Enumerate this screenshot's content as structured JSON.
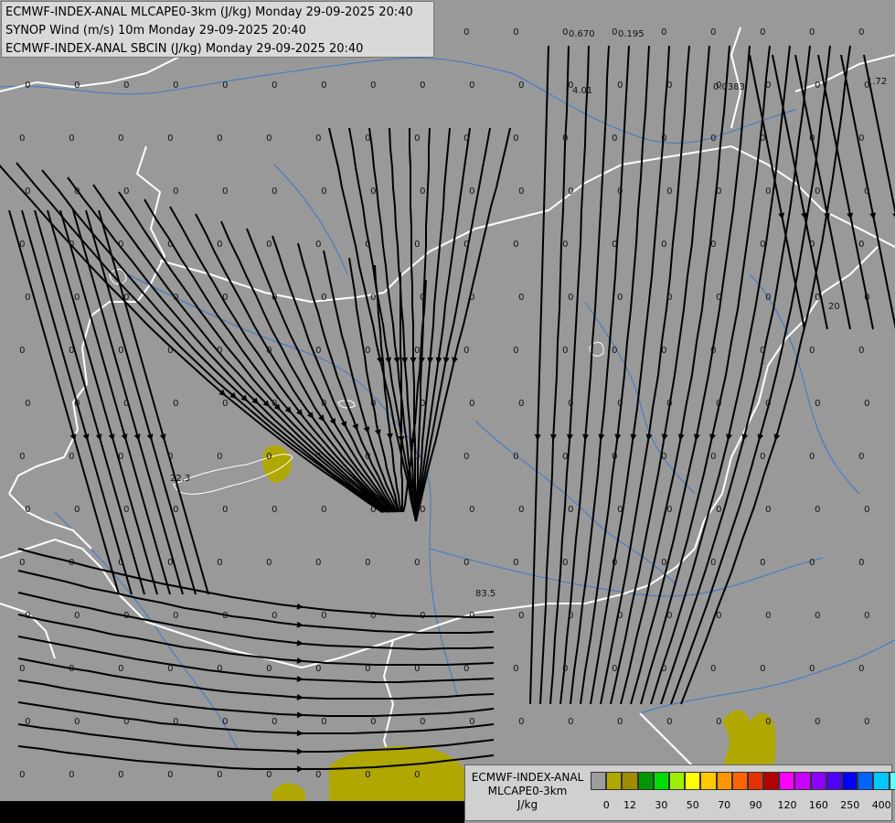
{
  "header": {
    "line1": "ECMWF-INDEX-ANAL MLCAPE0-3km (J/kg) Monday 29-09-2025 20:40",
    "line2": "SYNOP Wind (m/s) 10m Monday 29-09-2025 20:40",
    "line3": "ECMWF-INDEX-ANAL SBCIN (J/kg) Monday 29-09-2025 20:40"
  },
  "legend": {
    "title_line1": "ECMWF-INDEX-ANAL",
    "title_line2": "MLCAPE0-3km",
    "unit": "J/kg",
    "colors": [
      "#9c9c9c",
      "#b0a800",
      "#a08c00",
      "#009600",
      "#00dc00",
      "#9cf000",
      "#ffff00",
      "#ffc800",
      "#ff9600",
      "#ff6400",
      "#e13200",
      "#b40000",
      "#ff00ff",
      "#c800ff",
      "#8c00ff",
      "#5000ff",
      "#0000ff",
      "#0064ff",
      "#00c8ff",
      "#64ffff",
      "#ffffff"
    ],
    "ticks": [
      "0",
      "12",
      "30",
      "50",
      "70",
      "90",
      "120",
      "160",
      "250",
      "400"
    ]
  },
  "sbcin_labels": [
    {
      "text": "0.670"
    },
    {
      "text": "0.195"
    },
    {
      "text": "4.01"
    },
    {
      "text": "0.0383"
    },
    {
      "text": "1.72"
    },
    {
      "text": "22.3"
    },
    {
      "text": "83.5"
    },
    {
      "text": "20"
    }
  ],
  "colors": {
    "background": "#999999",
    "streamline": "#000000",
    "border": "#ffffff",
    "river": "#3c78c8",
    "cape_low": "#b0a800"
  }
}
